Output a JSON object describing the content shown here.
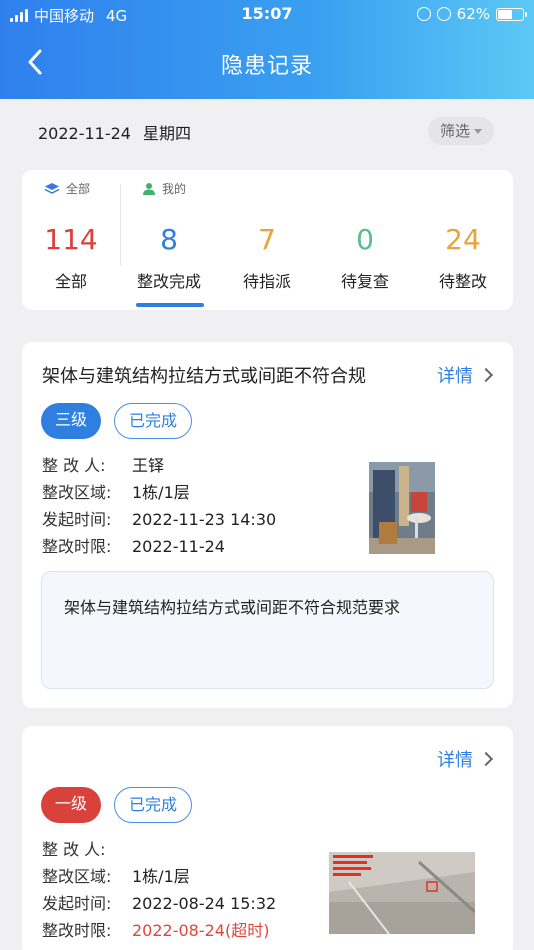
{
  "status_bar": {
    "carrier": "中国移动",
    "network": "4G",
    "time": "15:07",
    "battery": "62%",
    "battery_level": 0.62
  },
  "header": {
    "title": "隐患记录"
  },
  "date_bar": {
    "date": "2022-11-24",
    "weekday": "星期四",
    "filter_label": "筛选"
  },
  "stats": {
    "group_all": "全部",
    "group_mine": "我的",
    "items": [
      {
        "num": "114",
        "label": "全部",
        "color": "#d8423b"
      },
      {
        "num": "8",
        "label": "整改完成",
        "color": "#2f7fe0"
      },
      {
        "num": "7",
        "label": "待指派",
        "color": "#e8a33a"
      },
      {
        "num": "0",
        "label": "待复查",
        "color": "#5bbd8a"
      },
      {
        "num": "24",
        "label": "待整改",
        "color": "#e8a33a"
      }
    ]
  },
  "cards": [
    {
      "title": "架体与建筑结构拉结方式或间距不符合规",
      "detail_label": "详情",
      "level": "三级",
      "level_color": "#2f7fe0",
      "status": "已完成",
      "rows": [
        {
          "k": "整 改 人:",
          "v": "王铎"
        },
        {
          "k": "整改区域:",
          "v": "1栋/1层"
        },
        {
          "k": "发起时间:",
          "v": "2022-11-23 14:30"
        },
        {
          "k": "整改时限:",
          "v": "2022-11-24"
        }
      ],
      "description": "架体与建筑结构拉结方式或间距不符合规范要求"
    },
    {
      "title": "",
      "detail_label": "详情",
      "level": "一级",
      "level_color": "#d8423b",
      "status": "已完成",
      "rows": [
        {
          "k": "整 改 人:",
          "v": ""
        },
        {
          "k": "整改区域:",
          "v": "1栋/1层"
        },
        {
          "k": "发起时间:",
          "v": "2022-08-24 15:32"
        },
        {
          "k": "整改时限:",
          "v": "2022-08-24(超时)"
        }
      ]
    }
  ]
}
